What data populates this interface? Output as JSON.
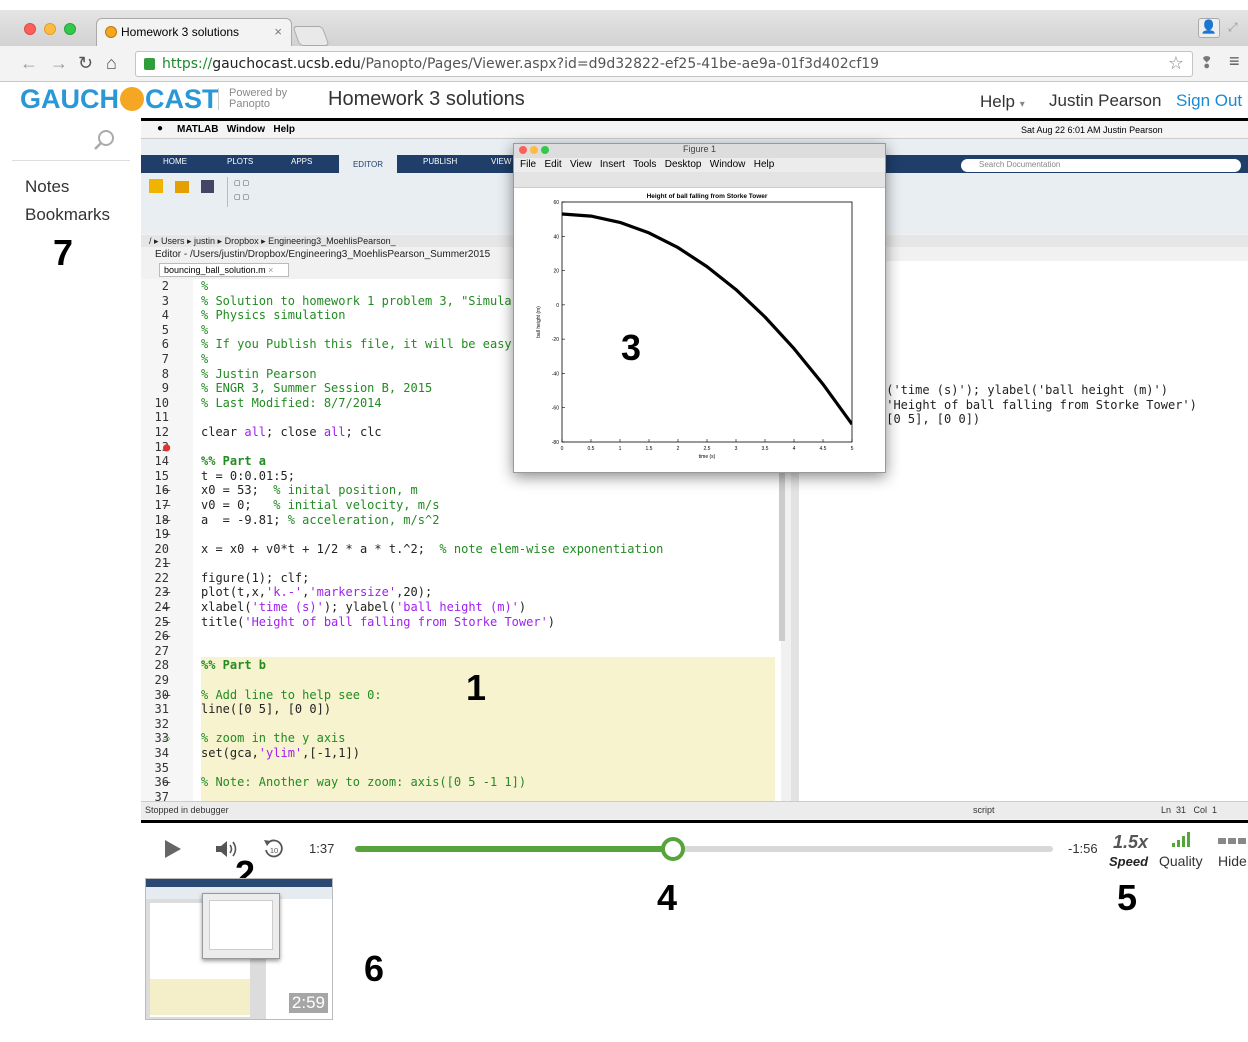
{
  "browser": {
    "tab_title": "Homework 3 solutions",
    "tab_close": "×",
    "url_scheme": "https://",
    "url_host": "gauchocast.ucsb.edu",
    "url_path": "/Panopto/Pages/Viewer.aspx?id=d9d32822-ef25-41be-ae9a-01f3d402cf19"
  },
  "header": {
    "logo_left": "GAUCH",
    "logo_right": "CAST",
    "powered_by_1": "Powered by",
    "powered_by_2": "Panopto",
    "title": "Homework 3 solutions",
    "help": "Help",
    "user": "Justin Pearson",
    "sign_out": "Sign Out"
  },
  "sidebar": {
    "notes": "Notes",
    "bookmarks": "Bookmarks",
    "callout": "7"
  },
  "callouts": {
    "c1": "1",
    "c2": "2",
    "c3": "3",
    "c4": "4",
    "c5": "5",
    "c6": "6"
  },
  "matlab": {
    "menubar": "MATLAB   Window   Help",
    "clock": "Sat Aug 22  6:01 AM   Justin Pearson",
    "tabs": [
      "HOME",
      "PLOTS",
      "APPS",
      "EDITOR",
      "PUBLISH",
      "VIEW"
    ],
    "path_bar": "/ ▸ Users ▸ justin ▸ Dropbox ▸ Engineering3_MoehlisPearson_",
    "editor_path": "Editor - /Users/justin/Dropbox/Engineering3_MoehlisPearson_Summer2015",
    "editor_tab": "bouncing_ball_solution.m",
    "status_left": "Stopped in debugger",
    "status_mid": "script",
    "status_right": "Ln  31   Col  1",
    "search_placeholder": "Search Documentation",
    "cmd_lines": [
      "l('time (s)'); ylabel('ball height (m)')",
      "('Height of ball falling from Storke Tower')",
      " [0 5], [0 0])"
    ]
  },
  "figure": {
    "window_title": "Figure 1",
    "menu": [
      "File",
      "Edit",
      "View",
      "Insert",
      "Tools",
      "Desktop",
      "Window",
      "Help"
    ]
  },
  "chart_data": {
    "type": "line",
    "title": "Height of ball falling from Storke Tower",
    "xlabel": "time (s)",
    "ylabel": "ball height (m)",
    "xlim": [
      0,
      5
    ],
    "ylim": [
      -80,
      60
    ],
    "xticks": [
      "0",
      "0.5",
      "1",
      "1.5",
      "2",
      "2.5",
      "3",
      "3.5",
      "4",
      "4.5",
      "5"
    ],
    "yticks": [
      "60",
      "40",
      "20",
      "0",
      "-20",
      "-40",
      "-60",
      "-80"
    ],
    "series": [
      {
        "equation": "53 - 4.905 t^2",
        "x": [
          0,
          0.5,
          1,
          1.5,
          2,
          2.5,
          3,
          3.5,
          4,
          4.5,
          5
        ],
        "y": [
          53,
          51.8,
          48.1,
          42.0,
          33.4,
          22.3,
          8.9,
          -7.1,
          -25.5,
          -46.3,
          -69.6
        ]
      }
    ]
  },
  "player": {
    "elapsed": "1:37",
    "remaining": "-1:56",
    "progress": 0.455,
    "speed_value": "1.5x",
    "speed_label": "Speed",
    "quality": "Quality",
    "hide": "Hide",
    "thumb_duration": "2:59"
  }
}
